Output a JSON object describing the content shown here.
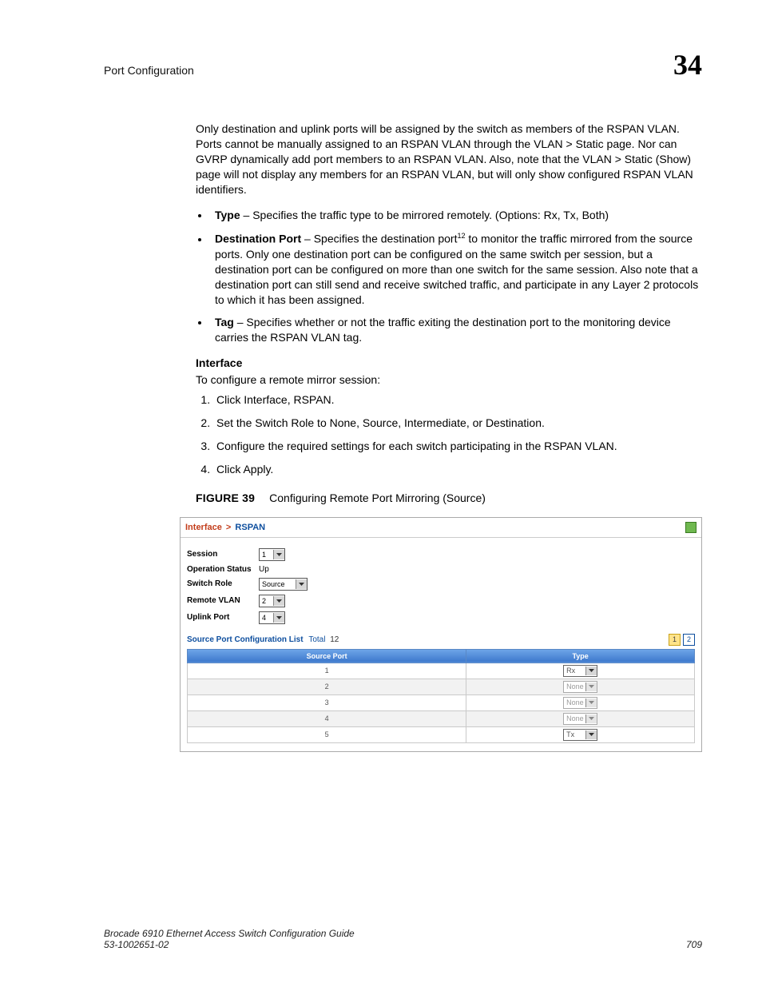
{
  "header": {
    "section_title": "Port Configuration",
    "chapter_number": "34"
  },
  "paragraphs": {
    "intro": "Only destination and uplink ports will be assigned by the switch as members of the RSPAN VLAN. Ports cannot be manually assigned to an RSPAN VLAN through the VLAN > Static page. Nor can GVRP dynamically add port members to an RSPAN VLAN. Also, note that the VLAN > Static (Show) page will not display any members for an RSPAN VLAN, but will only show configured RSPAN VLAN identifiers.",
    "interface_intro": "To configure a remote mirror session:"
  },
  "bullets": {
    "type": {
      "term": "Type",
      "desc": " – Specifies the traffic type to be mirrored remotely. (Options: Rx, Tx, Both)"
    },
    "dest": {
      "term": "Destination Port",
      "sup": "12",
      "desc_before": " – Specifies the destination port",
      "desc_after": " to monitor the traffic mirrored from the source ports. Only one destination port can be configured on the same switch per session, but a destination port can be configured on more than one switch for the same session. Also note that a destination port can still send and receive switched traffic, and participate in any Layer 2 protocols to which it has been assigned."
    },
    "tag": {
      "term": "Tag",
      "desc": " – Specifies whether or not the traffic exiting the destination port to the monitoring device carries the RSPAN VLAN tag."
    }
  },
  "section_heads": {
    "interface": "Interface"
  },
  "steps": [
    "Click Interface, RSPAN.",
    "Set the Switch Role to None, Source, Intermediate, or Destination.",
    "Configure the required settings for each switch participating in the RSPAN VLAN.",
    "Click Apply."
  ],
  "figure": {
    "label": "FIGURE 39",
    "caption": "Configuring Remote Port Mirroring (Source)"
  },
  "screenshot": {
    "breadcrumb": {
      "parent": "Interface",
      "child": "RSPAN"
    },
    "fields": {
      "session": {
        "label": "Session",
        "value": "1"
      },
      "op_status": {
        "label": "Operation Status",
        "value": "Up"
      },
      "switch_role": {
        "label": "Switch Role",
        "value": "Source"
      },
      "remote_vlan": {
        "label": "Remote VLAN",
        "value": "2"
      },
      "uplink_port": {
        "label": "Uplink Port",
        "value": "4"
      }
    },
    "list_title": {
      "main": "Source Port Configuration List",
      "total_label": "Total",
      "total_value": "12"
    },
    "pager": [
      "1",
      "2"
    ],
    "table": {
      "columns": [
        "Source Port",
        "Type"
      ],
      "rows": [
        {
          "port": "1",
          "type": "Rx",
          "disabled": false
        },
        {
          "port": "2",
          "type": "None",
          "disabled": true
        },
        {
          "port": "3",
          "type": "None",
          "disabled": true
        },
        {
          "port": "4",
          "type": "None",
          "disabled": true
        },
        {
          "port": "5",
          "type": "Tx",
          "disabled": false
        }
      ]
    }
  },
  "footer": {
    "title": "Brocade 6910 Ethernet Access Switch Configuration Guide",
    "docnum": "53-1002651-02",
    "page": "709"
  }
}
